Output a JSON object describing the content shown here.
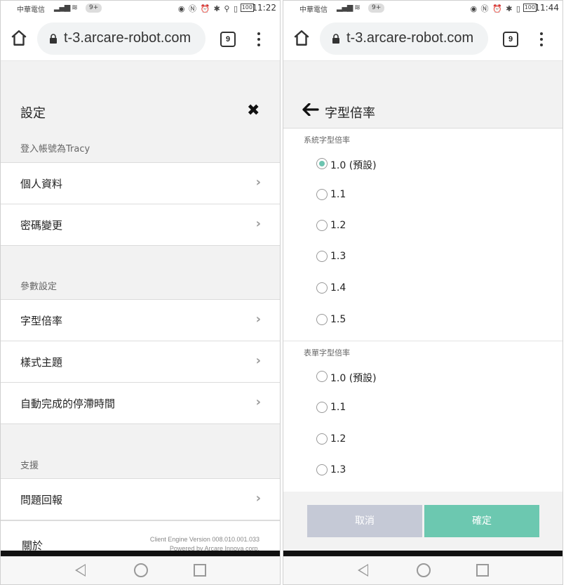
{
  "left": {
    "status": {
      "carrier": "中華電信",
      "badge": "9+",
      "battery": "100",
      "time": "11:22"
    },
    "browser": {
      "url": "t-3.arcare-robot.com",
      "tab_count": "9"
    },
    "title": "設定",
    "login_section": "登入帳號為Tracy",
    "account_items": [
      {
        "label": "個人資料"
      },
      {
        "label": "密碼變更"
      }
    ],
    "param_section": "參數設定",
    "param_items": [
      {
        "label": "字型倍率"
      },
      {
        "label": "樣式主題"
      },
      {
        "label": "自動完成的停滯時間"
      }
    ],
    "support_section": "支援",
    "support_items": [
      {
        "label": "問題回報"
      }
    ],
    "about_label": "關於",
    "version_line1": "Client Engine Version 008.010.001.033",
    "version_line2": "Powered by Arcare Innova corp."
  },
  "right": {
    "status": {
      "carrier": "中華電信",
      "badge": "9+",
      "battery": "100",
      "time": "11:44"
    },
    "browser": {
      "url": "t-3.arcare-robot.com",
      "tab_count": "9"
    },
    "title": "字型倍率",
    "system_group": {
      "label": "系統字型倍率",
      "options": [
        "1.0 (預設)",
        "1.1",
        "1.2",
        "1.3",
        "1.4",
        "1.5"
      ],
      "selected": "1.0 (預設)"
    },
    "form_group": {
      "label": "表單字型倍率",
      "options": [
        "1.0 (預設)",
        "1.1",
        "1.2",
        "1.3"
      ],
      "selected": ""
    },
    "cancel_label": "取消",
    "ok_label": "確定",
    "colors": {
      "accent": "#6cc8b0",
      "cancel": "#c5c9d6"
    }
  }
}
